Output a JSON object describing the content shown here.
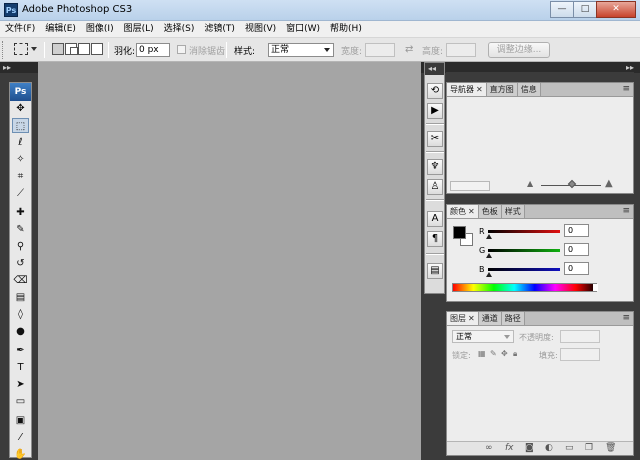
{
  "window": {
    "title": "Adobe Photoshop CS3",
    "logo": "Ps",
    "buttons": {
      "minimize": "—",
      "maximize": "□",
      "close": "✕"
    }
  },
  "menu": [
    "文件(F)",
    "编辑(E)",
    "图像(I)",
    "图层(L)",
    "选择(S)",
    "滤镜(T)",
    "视图(V)",
    "窗口(W)",
    "帮助(H)"
  ],
  "options": {
    "feather_label": "羽化:",
    "feather_value": "0 px",
    "antialias_label": "消除锯齿",
    "style_label": "样式:",
    "style_value": "正常",
    "width_label": "宽度:",
    "height_label": "高度:",
    "refine_button": "调整边缘..."
  },
  "toolbox": {
    "logo": "Ps",
    "tools": [
      {
        "name": "move-tool",
        "glyph": "✥"
      },
      {
        "name": "marquee-tool",
        "glyph": "⬚"
      },
      {
        "name": "lasso-tool",
        "glyph": "ℓ"
      },
      {
        "name": "magic-wand-tool",
        "glyph": "✧"
      },
      {
        "name": "crop-tool",
        "glyph": "⌗"
      },
      {
        "name": "slice-tool",
        "glyph": "⟋"
      },
      {
        "name": "healing-brush-tool",
        "glyph": "✚"
      },
      {
        "name": "brush-tool",
        "glyph": "✎"
      },
      {
        "name": "clone-stamp-tool",
        "glyph": "⚲"
      },
      {
        "name": "history-brush-tool",
        "glyph": "↺"
      },
      {
        "name": "eraser-tool",
        "glyph": "⌫"
      },
      {
        "name": "gradient-tool",
        "glyph": "▤"
      },
      {
        "name": "blur-tool",
        "glyph": "◊"
      },
      {
        "name": "dodge-tool",
        "glyph": "●"
      },
      {
        "name": "pen-tool",
        "glyph": "✒"
      },
      {
        "name": "type-tool",
        "glyph": "T"
      },
      {
        "name": "path-selection-tool",
        "glyph": "➤"
      },
      {
        "name": "shape-tool",
        "glyph": "▭"
      },
      {
        "name": "notes-tool",
        "glyph": "▣"
      },
      {
        "name": "eyedropper-tool",
        "glyph": "⁄"
      },
      {
        "name": "hand-tool",
        "glyph": "✋"
      }
    ]
  },
  "panels": {
    "navigator_tabs": [
      "导航器",
      "直方图",
      "信息"
    ],
    "color_tabs": [
      "颜色",
      "色板",
      "样式"
    ],
    "layers_tabs": [
      "图层",
      "通道",
      "路径"
    ],
    "channels": [
      {
        "label": "R",
        "value": "0",
        "color": "#e01010"
      },
      {
        "label": "G",
        "value": "0",
        "color": "#10b010"
      },
      {
        "label": "B",
        "value": "0",
        "color": "#1010c0"
      }
    ],
    "layers": {
      "blend_mode": "正常",
      "opacity_label": "不透明度:",
      "lock_label": "锁定:",
      "fill_label": "填充:"
    }
  },
  "icons": {
    "panel_close": "✕",
    "panel_menu": "≡",
    "collapse": "▸▸",
    "expand": "◂◂",
    "swap": "⇄"
  }
}
